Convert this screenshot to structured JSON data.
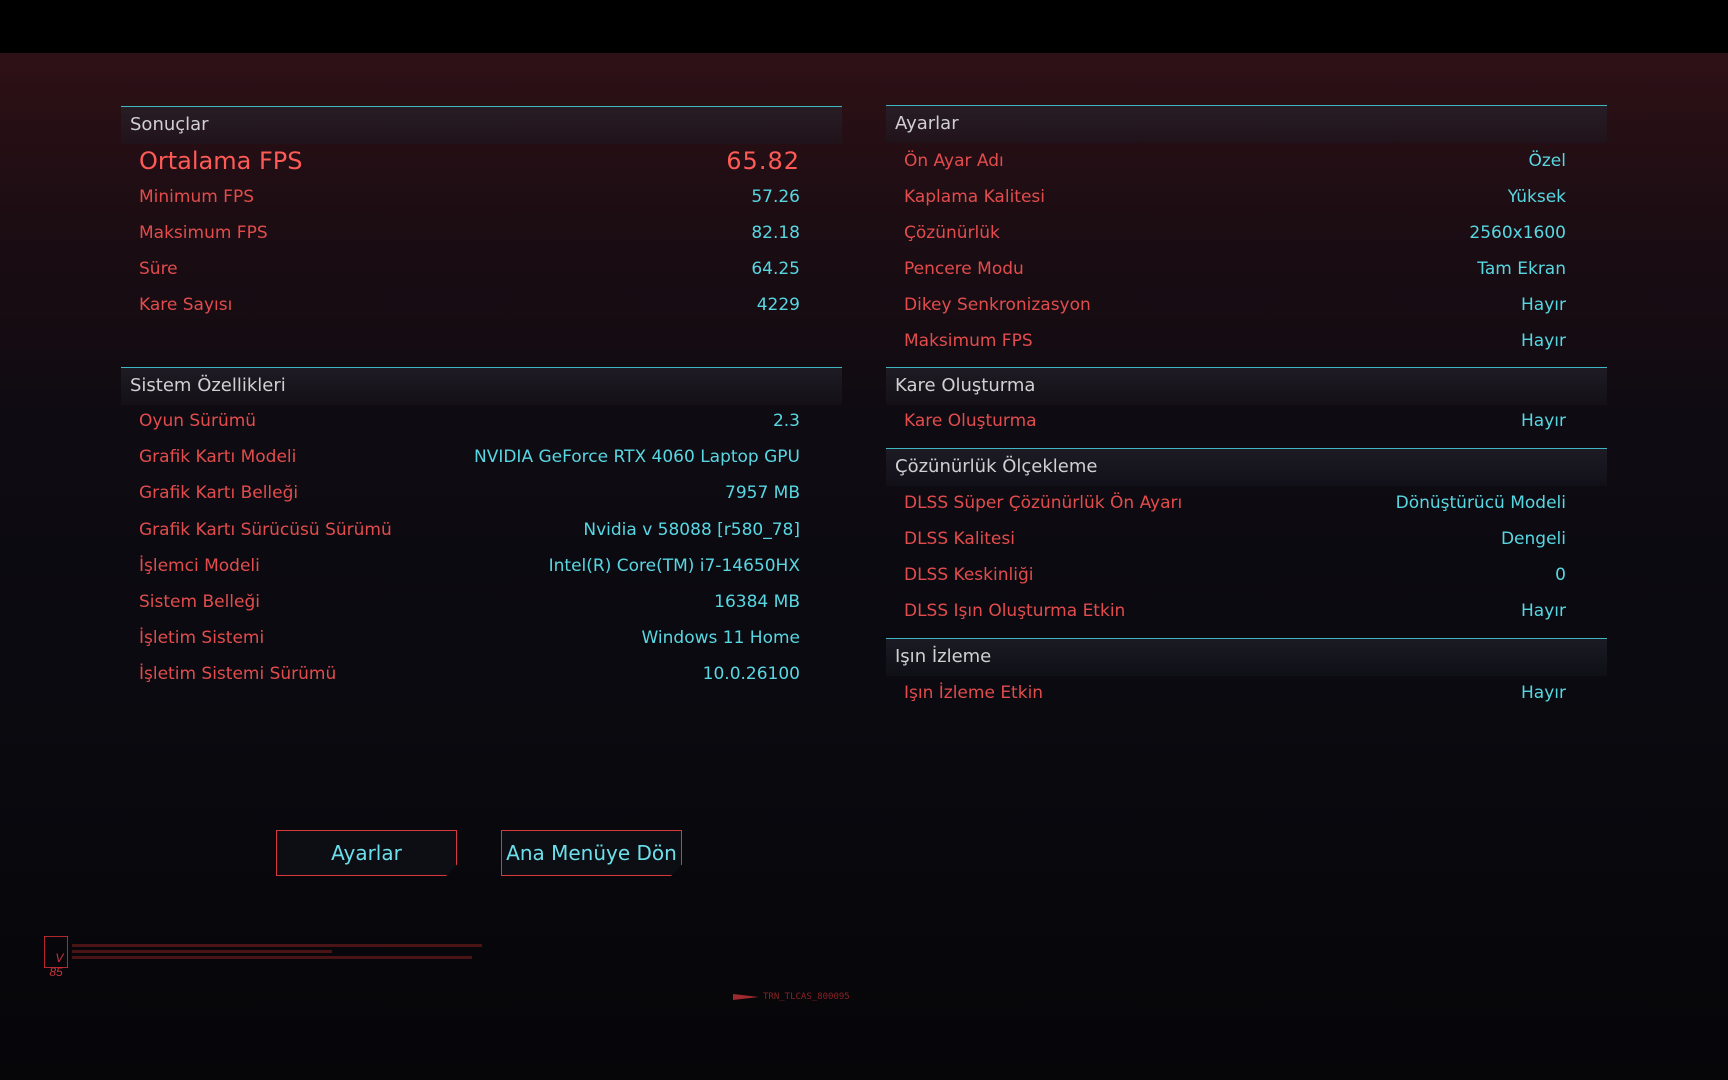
{
  "results": {
    "title": "Sonuçlar",
    "rows": [
      {
        "label": "Ortalama FPS",
        "value": "65.82"
      },
      {
        "label": "Minimum FPS",
        "value": "57.26"
      },
      {
        "label": "Maksimum FPS",
        "value": "82.18"
      },
      {
        "label": "Süre",
        "value": "64.25"
      },
      {
        "label": "Kare Sayısı",
        "value": "4229"
      }
    ]
  },
  "system": {
    "title": "Sistem Özellikleri",
    "rows": [
      {
        "label": "Oyun Sürümü",
        "value": "2.3"
      },
      {
        "label": "Grafik Kartı Modeli",
        "value": "NVIDIA GeForce RTX 4060 Laptop GPU"
      },
      {
        "label": "Grafik Kartı Belleği",
        "value": "7957 MB"
      },
      {
        "label": "Grafik Kartı Sürücüsü Sürümü",
        "value": "Nvidia v 58088 [r580_78]"
      },
      {
        "label": "İşlemci Modeli",
        "value": "Intel(R) Core(TM) i7-14650HX"
      },
      {
        "label": "Sistem Belleği",
        "value": "16384 MB"
      },
      {
        "label": "İşletim Sistemi",
        "value": "Windows 11 Home"
      },
      {
        "label": "İşletim Sistemi Sürümü",
        "value": "10.0.26100"
      }
    ]
  },
  "settings": {
    "title": "Ayarlar",
    "rows": [
      {
        "label": "Ön Ayar Adı",
        "value": "Özel"
      },
      {
        "label": "Kaplama Kalitesi",
        "value": "Yüksek"
      },
      {
        "label": "Çözünürlük",
        "value": "2560x1600"
      },
      {
        "label": "Pencere Modu",
        "value": "Tam Ekran"
      },
      {
        "label": "Dikey Senkronizasyon",
        "value": "Hayır"
      },
      {
        "label": "Maksimum FPS",
        "value": "Hayır"
      }
    ]
  },
  "frame_gen": {
    "title": "Kare Oluşturma",
    "rows": [
      {
        "label": "Kare Oluşturma",
        "value": "Hayır"
      }
    ]
  },
  "scaling": {
    "title": "Çözünürlük Ölçekleme",
    "rows": [
      {
        "label": "DLSS Süper Çözünürlük Ön Ayarı",
        "value": "Dönüştürücü Modeli"
      },
      {
        "label": "DLSS Kalitesi",
        "value": "Dengeli"
      },
      {
        "label": "DLSS Keskinliği",
        "value": "0"
      },
      {
        "label": "DLSS Işın Oluşturma Etkin",
        "value": "Hayır"
      }
    ]
  },
  "raytracing": {
    "title": "Işın İzleme",
    "rows": [
      {
        "label": "Işın İzleme Etkin",
        "value": "Hayır"
      }
    ]
  },
  "buttons": {
    "settings": "Ayarlar",
    "main_menu": "Ana Menüye Dön"
  },
  "decor": {
    "logo": "V\n85",
    "code": "TRN_TLCAS_800095"
  },
  "colors": {
    "label_red": "#e24c4c",
    "value_cyan": "#58d7e2",
    "accent_line": "#3fb7c2",
    "button_border": "#d9383d"
  }
}
